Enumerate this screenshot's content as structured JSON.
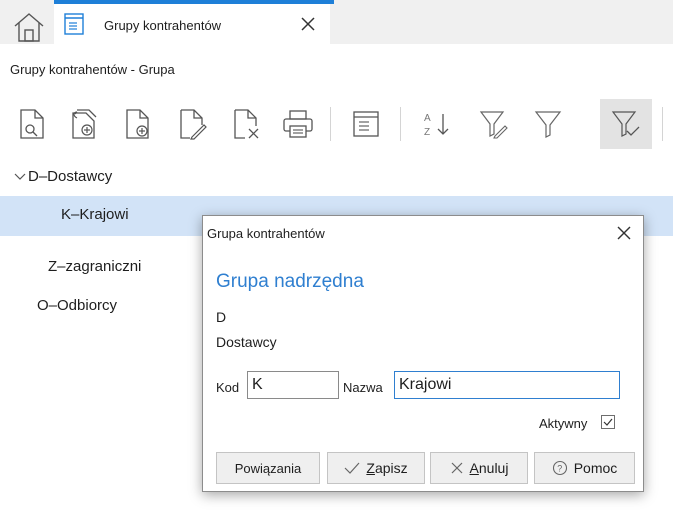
{
  "tabbar": {
    "home_icon": "home-icon",
    "tab": {
      "label": "Grupy kontrahentów",
      "icon": "document-list-icon",
      "close_icon": "close-icon"
    },
    "accent_color": "#1e7fd8"
  },
  "page": {
    "subtitle": "Grupy kontrahentów - Grupa"
  },
  "toolbar": {
    "buttons": [
      {
        "name": "preview",
        "icon": "document-preview-icon"
      },
      {
        "name": "copy",
        "icon": "document-copy-icon"
      },
      {
        "name": "add",
        "icon": "document-add-icon"
      },
      {
        "name": "edit",
        "icon": "document-edit-icon"
      },
      {
        "name": "delete",
        "icon": "document-delete-icon"
      },
      {
        "name": "print",
        "icon": "printer-icon"
      },
      {
        "name": "view",
        "icon": "window-list-icon"
      },
      {
        "name": "sort",
        "icon": "sort-az-icon"
      },
      {
        "name": "filter-edit",
        "icon": "filter-edit-icon"
      },
      {
        "name": "filter",
        "icon": "filter-icon"
      },
      {
        "name": "filter-active",
        "icon": "filter-check-icon",
        "active": true
      }
    ]
  },
  "tree": {
    "items": [
      {
        "label": "D–Dostawcy",
        "expanded": true
      },
      {
        "label": "K–Krajowi",
        "selected": true
      },
      {
        "label": "Z–zagraniczni"
      },
      {
        "label": "O–Odbiorcy"
      }
    ],
    "selected_color": "#d2e3f7"
  },
  "dialog": {
    "title": "Grupa kontrahentów",
    "section_title": "Grupa nadrzędna",
    "parent_code": "D",
    "parent_name": "Dostawcy",
    "code_label": "Kod",
    "code_value": "K",
    "name_label": "Nazwa",
    "name_value": "Krajowi",
    "active_label": "Aktywny",
    "active_checked": true,
    "buttons": {
      "relations": "Powiązania",
      "save_mnemonic": "Z",
      "save_rest": "apisz",
      "cancel_mnemonic": "A",
      "cancel_rest": "nuluj",
      "help": "Pomoc"
    },
    "accent_color": "#2f7fd0"
  }
}
